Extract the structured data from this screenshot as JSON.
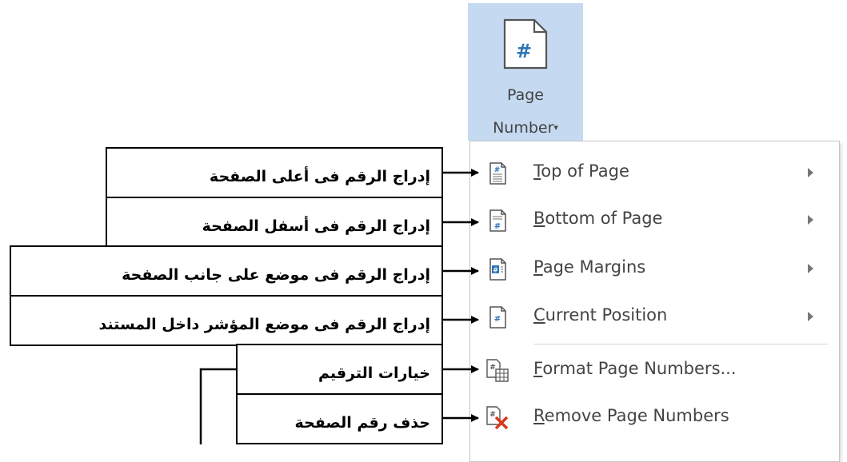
{
  "ribbon_button": {
    "icon": "page-number-icon",
    "icon_glyph": "#",
    "label_line1": "Page",
    "label_line2": "Number",
    "dropdown_caret": "▾"
  },
  "menu": {
    "items": [
      {
        "icon": "top-of-page-icon",
        "accel": "T",
        "rest": "op of Page",
        "has_submenu": true
      },
      {
        "icon": "bottom-of-page-icon",
        "accel": "B",
        "rest": "ottom of Page",
        "has_submenu": true
      },
      {
        "icon": "page-margins-icon",
        "accel": "P",
        "rest": "age Margins",
        "has_submenu": true
      },
      {
        "icon": "current-position-icon",
        "accel": "C",
        "rest": "urrent Position",
        "has_submenu": true
      },
      {
        "icon": "format-page-numbers-icon",
        "accel": "F",
        "rest": "ormat Page Numbers...",
        "has_submenu": false
      },
      {
        "icon": "remove-page-numbers-icon",
        "accel": "R",
        "rest": "emove Page Numbers",
        "has_submenu": false
      }
    ]
  },
  "callouts": [
    {
      "text": "إدراج الرقم فى أعلى الصفحة"
    },
    {
      "text": "إدراج الرقم فى أسفل الصفحة"
    },
    {
      "text": "إدراج الرقم فى موضع على جانب الصفحة"
    },
    {
      "text": "إدراج الرقم فى موضع المؤشر داخل المستند"
    },
    {
      "text": "خيارات الترقيم"
    },
    {
      "text": "حذف رقم الصفحة"
    }
  ],
  "colors": {
    "ribbon_highlight": "#c5d9f1",
    "icon_blue": "#2e75b6",
    "remove_red": "#d9381e"
  }
}
